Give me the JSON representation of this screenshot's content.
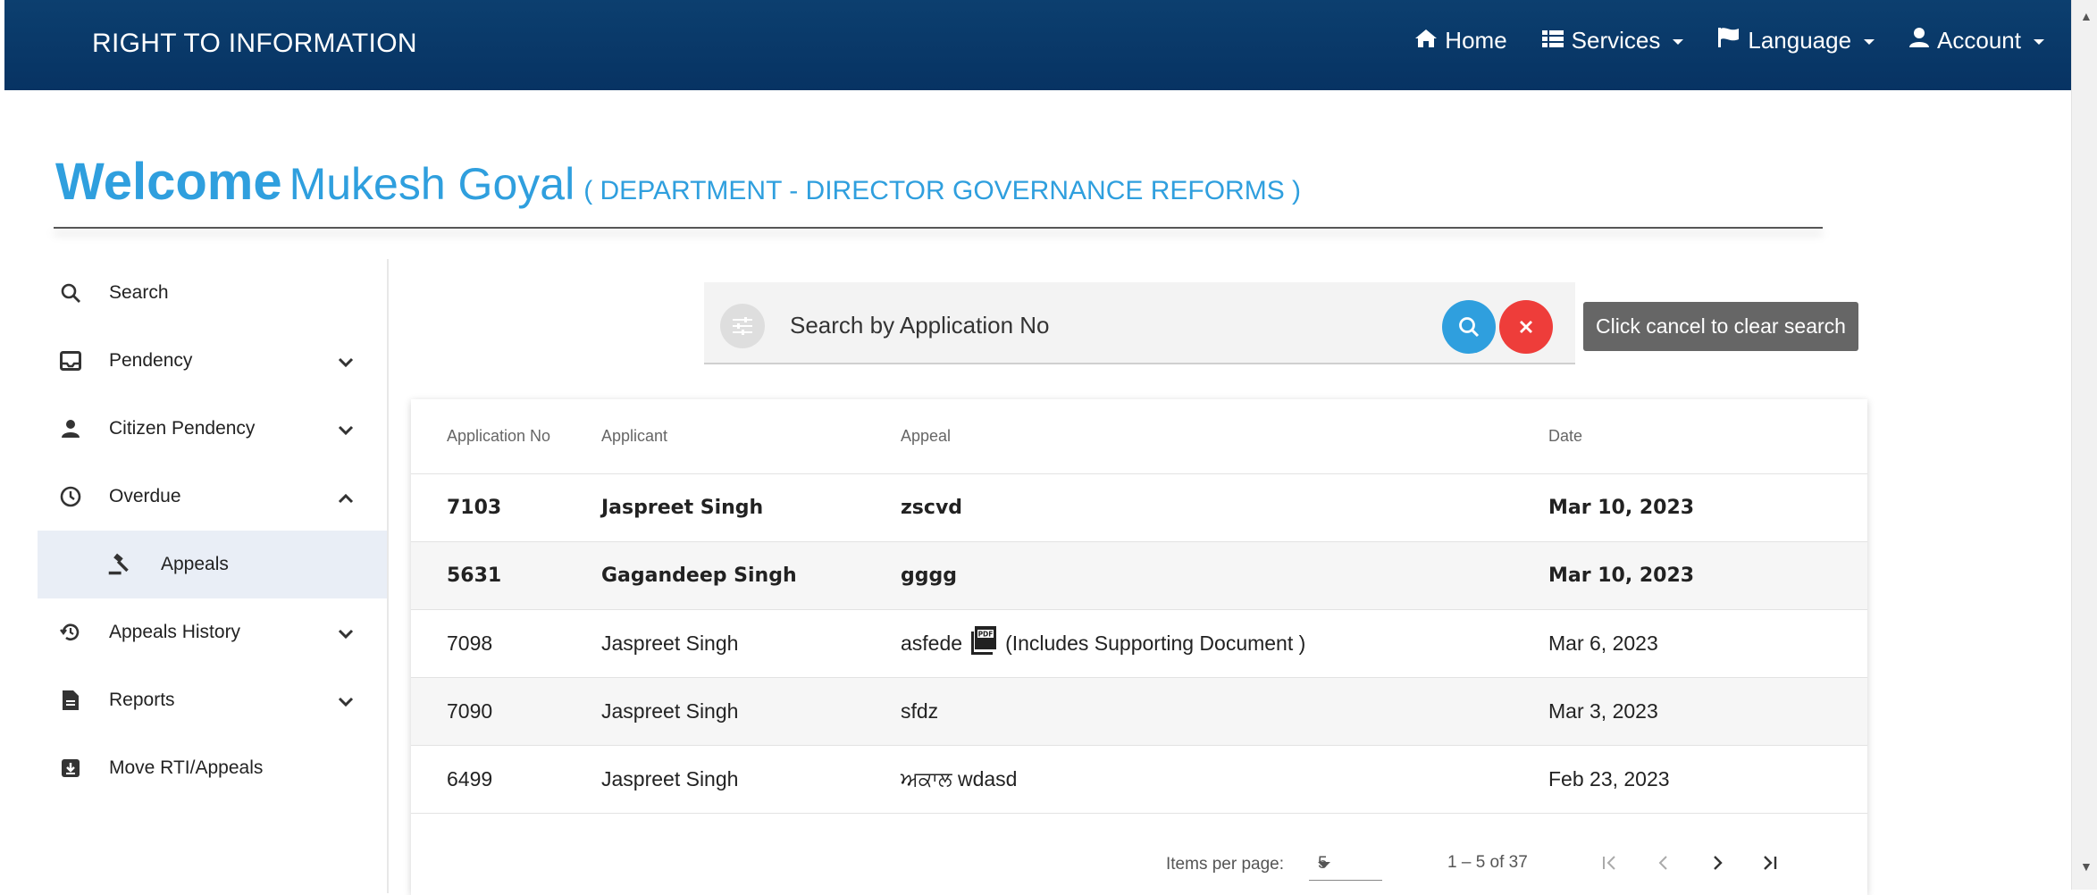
{
  "app_title": "RIGHT TO INFORMATION",
  "nav": {
    "home": "Home",
    "services": "Services",
    "language": "Language",
    "account": "Account"
  },
  "welcome": {
    "word": "Welcome",
    "user": "Mukesh Goyal",
    "department": "( DEPARTMENT - DIRECTOR GOVERNANCE REFORMS )"
  },
  "sidebar": {
    "search": "Search",
    "pendency": "Pendency",
    "citizen_pendency": "Citizen Pendency",
    "overdue": "Overdue",
    "appeals": "Appeals",
    "appeals_history": "Appeals History",
    "reports": "Reports",
    "move": "Move RTI/Appeals"
  },
  "search": {
    "placeholder": "Search by Application No",
    "tooltip": "Click cancel to clear search"
  },
  "table": {
    "headers": [
      "Application No",
      "Applicant",
      "Appeal",
      "Date"
    ],
    "rows": [
      {
        "app_no": "7103",
        "applicant": "Jaspreet Singh",
        "appeal": "zscvd",
        "note": "",
        "date": "Mar 10, 2023"
      },
      {
        "app_no": "5631",
        "applicant": "Gagandeep Singh",
        "appeal": "gggg",
        "note": "",
        "date": "Mar 10, 2023"
      },
      {
        "app_no": "7098",
        "applicant": "Jaspreet Singh",
        "appeal": "asfede",
        "note": "(Includes Supporting Document )",
        "date": "Mar 6, 2023"
      },
      {
        "app_no": "7090",
        "applicant": "Jaspreet Singh",
        "appeal": "sfdz",
        "note": "",
        "date": "Mar 3, 2023"
      },
      {
        "app_no": "6499",
        "applicant": "Jaspreet Singh",
        "appeal": "ਅਕਾਲ wdasd",
        "note": "",
        "date": "Feb 23, 2023"
      }
    ]
  },
  "paginator": {
    "label": "Items per page:",
    "page_size": "5",
    "range": "1 – 5 of 37"
  },
  "colors": {
    "topbar": "#0a3a6b",
    "accent": "#2f9fde",
    "cancel": "#ee3d3a",
    "selected": "#e9eef6"
  },
  "icons": [
    "home-icon",
    "list-icon",
    "flag-icon",
    "user-icon",
    "search-icon",
    "inbox-icon",
    "person-icon",
    "clock-icon",
    "gavel-icon",
    "history-icon",
    "file-icon",
    "move-icon",
    "chevron-down-icon",
    "chevron-up-icon",
    "filter-icon",
    "close-icon",
    "pdf-icon",
    "first-page-icon",
    "prev-page-icon",
    "next-page-icon",
    "last-page-icon"
  ]
}
